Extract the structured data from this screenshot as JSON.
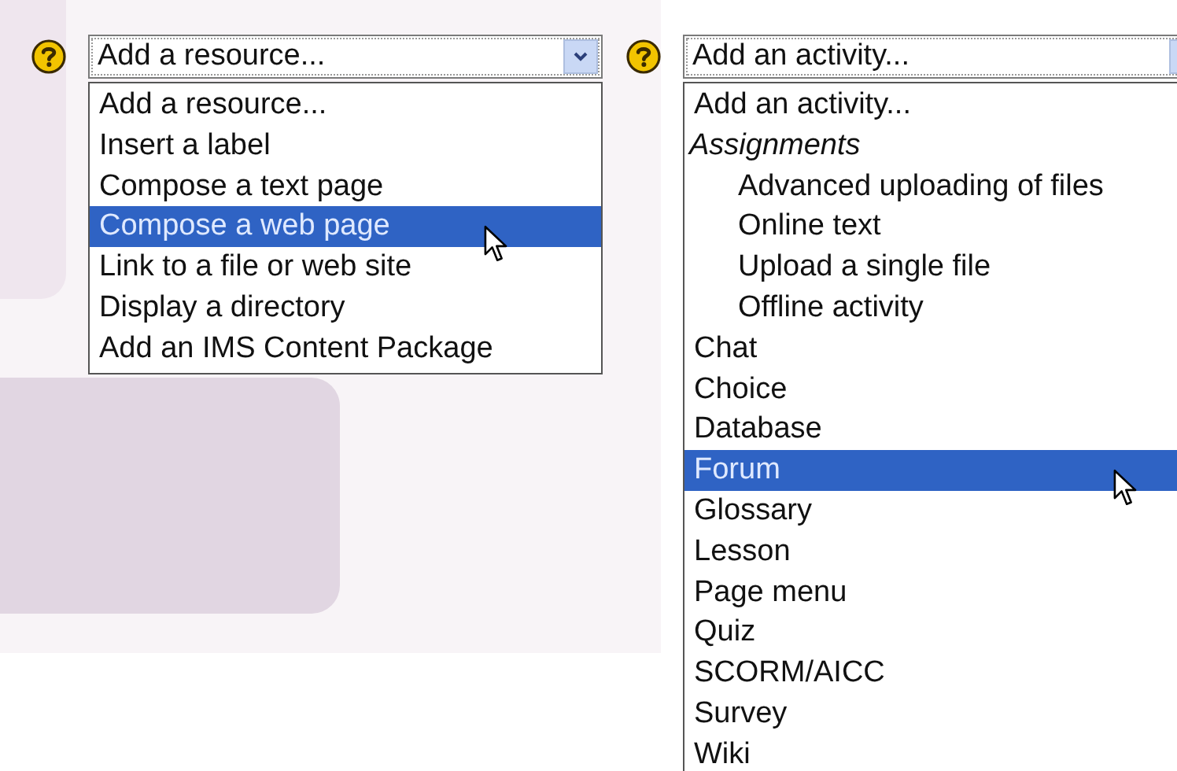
{
  "resource_menu": {
    "value": "Add a resource...",
    "options": [
      {
        "kind": "option",
        "label": "Add a resource...",
        "highlighted": false
      },
      {
        "kind": "option",
        "label": "Insert a label",
        "highlighted": false
      },
      {
        "kind": "option",
        "label": "Compose a text page",
        "highlighted": false
      },
      {
        "kind": "option",
        "label": "Compose a web page",
        "highlighted": true
      },
      {
        "kind": "option",
        "label": "Link to a file or web site",
        "highlighted": false
      },
      {
        "kind": "option",
        "label": "Display a directory",
        "highlighted": false
      },
      {
        "kind": "option",
        "label": "Add an IMS Content Package",
        "highlighted": false
      }
    ]
  },
  "activity_menu": {
    "value": "Add an activity...",
    "options": [
      {
        "kind": "option",
        "label": "Add an activity...",
        "highlighted": false
      },
      {
        "kind": "group",
        "label": "Assignments",
        "children": [
          {
            "kind": "option",
            "label": "Advanced uploading of files",
            "highlighted": false
          },
          {
            "kind": "option",
            "label": "Online text",
            "highlighted": false
          },
          {
            "kind": "option",
            "label": "Upload a single file",
            "highlighted": false
          },
          {
            "kind": "option",
            "label": "Offline activity",
            "highlighted": false
          }
        ]
      },
      {
        "kind": "option",
        "label": "Chat",
        "highlighted": false
      },
      {
        "kind": "option",
        "label": "Choice",
        "highlighted": false
      },
      {
        "kind": "option",
        "label": "Database",
        "highlighted": false
      },
      {
        "kind": "option",
        "label": "Forum",
        "highlighted": true
      },
      {
        "kind": "option",
        "label": "Glossary",
        "highlighted": false
      },
      {
        "kind": "option",
        "label": "Lesson",
        "highlighted": false
      },
      {
        "kind": "option",
        "label": "Page menu",
        "highlighted": false
      },
      {
        "kind": "option",
        "label": "Quiz",
        "highlighted": false
      },
      {
        "kind": "option",
        "label": "SCORM/AICC",
        "highlighted": false
      },
      {
        "kind": "option",
        "label": "Survey",
        "highlighted": false
      },
      {
        "kind": "option",
        "label": "Wiki",
        "highlighted": false
      }
    ]
  }
}
